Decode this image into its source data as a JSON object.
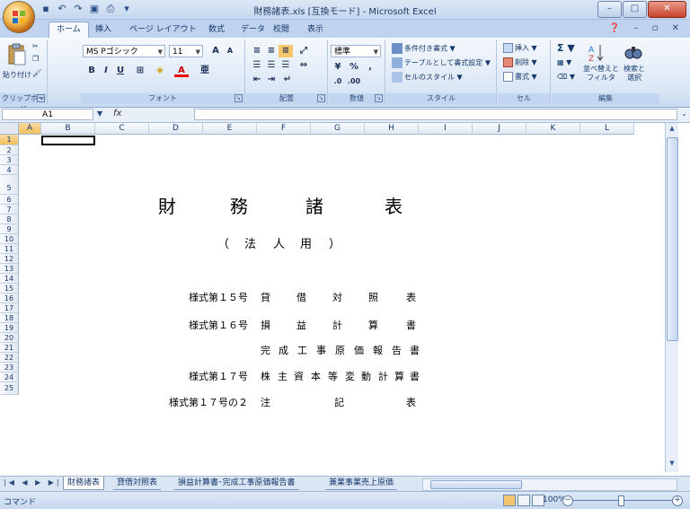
{
  "window": {
    "title": "財務諸表.xls [互換モード] - Microsoft Excel",
    "minimize": "–",
    "maximize": "□",
    "close": "✕"
  },
  "tabs": [
    "ホーム",
    "挿入",
    "ページ レイアウト",
    "数式",
    "データ",
    "校閲",
    "表示"
  ],
  "tab_right": "❓ – ▫ ✕",
  "ribbon": {
    "clipboard": {
      "paste": "貼り付け",
      "label": "クリップボード"
    },
    "font": {
      "name": "MS Pゴシック",
      "size": "11",
      "bold": "B",
      "italic": "I",
      "underline": "U",
      "grow": "A",
      "shrink": "A",
      "label": "フォント"
    },
    "alignment": {
      "label": "配置"
    },
    "number": {
      "format": "標準",
      "percent": "%",
      "comma": ",",
      "label": "数値"
    },
    "styles": {
      "cond": "条件付き書式",
      "table": "テーブルとして書式設定",
      "cell": "セルのスタイル",
      "label": "スタイル"
    },
    "cells": {
      "insert": "挿入",
      "delete": "削除",
      "format": "書式",
      "label": "セル"
    },
    "editing": {
      "sum": "Σ",
      "sort": "並べ替えと フィルタ",
      "find": "検索と 選択",
      "label": "編集"
    }
  },
  "formula_bar": {
    "name_box": "A1",
    "fx": "fx",
    "value": ""
  },
  "columns": [
    "A",
    "B",
    "C",
    "D",
    "E",
    "F",
    "G",
    "H",
    "I",
    "J",
    "K",
    "L"
  ],
  "rows": [
    "1",
    "2",
    "3",
    "4",
    "5",
    "6",
    "7",
    "8",
    "9",
    "10",
    "11",
    "12",
    "13",
    "14",
    "15",
    "16",
    "17",
    "18",
    "19",
    "20",
    "21",
    "22",
    "23",
    "24",
    "25"
  ],
  "sheet": {
    "title": [
      "財",
      "務",
      "諸",
      "表"
    ],
    "subtitle": [
      "（",
      "法",
      "人",
      "用",
      "）"
    ],
    "items": [
      {
        "code": "様式第１５号",
        "chars": [
          "貸",
          "借",
          "対",
          "照",
          "表"
        ]
      },
      {
        "code": "様式第１６号",
        "chars": [
          "損",
          "益",
          "計",
          "算",
          "書"
        ]
      },
      {
        "code": "",
        "chars": [
          "完",
          "成",
          "工",
          "事",
          "原",
          "価",
          "報",
          "告",
          "書"
        ]
      },
      {
        "code": "様式第１７号",
        "chars": [
          "株",
          "主",
          "資",
          "本",
          "等",
          "変",
          "動",
          "計",
          "算",
          "書"
        ]
      },
      {
        "code": "様式第１７号の２",
        "chars": [
          "注",
          "記",
          "表"
        ]
      }
    ]
  },
  "sheet_tabs": [
    "財務諸表",
    "貸借対照表",
    "損益計算書･完成工事原価報告書",
    "兼業事業売上原価"
  ],
  "status": {
    "mode": "コマンド",
    "zoom": "100%"
  }
}
